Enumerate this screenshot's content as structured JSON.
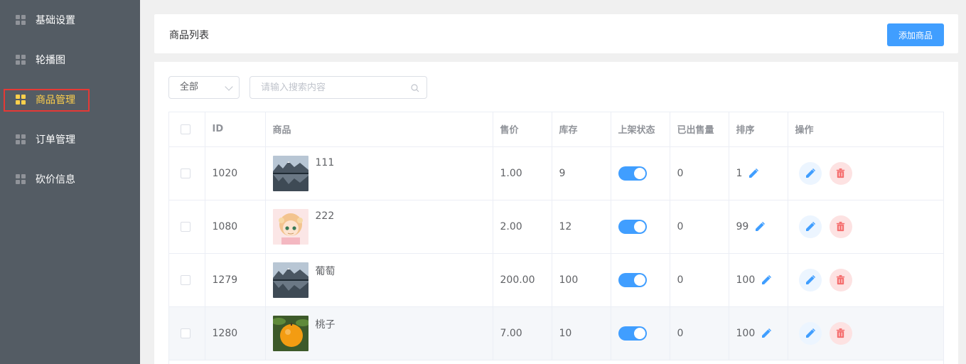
{
  "sidebar": {
    "items": [
      {
        "label": "基础设置",
        "icon": "grid-icon",
        "active": false
      },
      {
        "label": "轮播图",
        "icon": "grid-icon",
        "active": false
      },
      {
        "label": "商品管理",
        "icon": "grid-icon",
        "active": true
      },
      {
        "label": "订单管理",
        "icon": "grid-icon",
        "active": false
      },
      {
        "label": "砍价信息",
        "icon": "grid-icon",
        "active": false
      }
    ]
  },
  "header": {
    "title": "商品列表",
    "add_button": "添加商品"
  },
  "filters": {
    "category_selected": "全部",
    "search_placeholder": "请输入搜索内容"
  },
  "table": {
    "columns": [
      "",
      "ID",
      "商品",
      "售价",
      "库存",
      "上架状态",
      "已出售量",
      "排序",
      "操作"
    ],
    "rows": [
      {
        "id": "1020",
        "name": "111",
        "thumb": "mountain-lake",
        "price": "1.00",
        "stock": "9",
        "on_shelf": true,
        "sold": "0",
        "sort": "1"
      },
      {
        "id": "1080",
        "name": "222",
        "thumb": "anime-girl",
        "price": "2.00",
        "stock": "12",
        "on_shelf": true,
        "sold": "0",
        "sort": "99"
      },
      {
        "id": "1279",
        "name": "葡萄",
        "thumb": "mountain-lake",
        "price": "200.00",
        "stock": "100",
        "on_shelf": true,
        "sold": "0",
        "sort": "100"
      },
      {
        "id": "1280",
        "name": "桃子",
        "thumb": "orange-fruit",
        "price": "7.00",
        "stock": "10",
        "on_shelf": true,
        "sold": "0",
        "sort": "100"
      }
    ]
  },
  "colors": {
    "sidebar_bg": "#545c64",
    "active_text": "#ffd04b",
    "primary": "#409eff",
    "danger": "#f56c6c"
  }
}
